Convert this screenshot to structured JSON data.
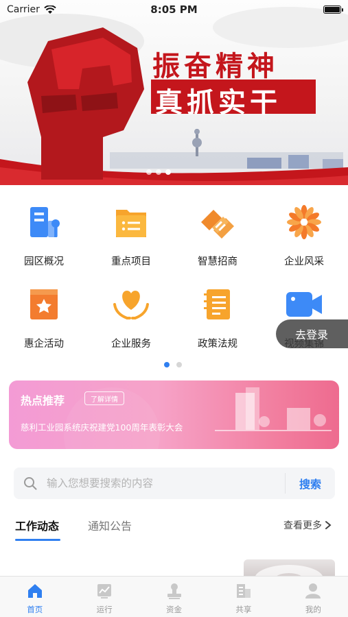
{
  "status_bar": {
    "carrier": "Carrier",
    "time": "8:05 PM"
  },
  "banner": {
    "slogan_line1": "振奋精神",
    "slogan_line2": "真抓实干",
    "slide_count": 3,
    "active_slide": 2
  },
  "grid": {
    "items": [
      {
        "label": "园区概况",
        "icon": "building-icon"
      },
      {
        "label": "重点项目",
        "icon": "folder-list-icon"
      },
      {
        "label": "智慧招商",
        "icon": "handshake-icon"
      },
      {
        "label": "企业风采",
        "icon": "flower-icon"
      },
      {
        "label": "惠企活动",
        "icon": "star-ribbon-icon"
      },
      {
        "label": "企业服务",
        "icon": "heart-hands-icon"
      },
      {
        "label": "政策法规",
        "icon": "document-icon"
      },
      {
        "label": "视频集锦",
        "icon": "video-camera-icon"
      }
    ],
    "page_count": 2,
    "active_page": 0
  },
  "login_pill": {
    "label": "去登录"
  },
  "hot": {
    "title": "热点推荐",
    "detail_label": "了解详情",
    "text": "慈利工业园系统庆祝建党100周年表彰大会"
  },
  "search": {
    "placeholder": "输入您想要搜索的内容",
    "button": "搜索"
  },
  "tabs": {
    "work": "工作动态",
    "notice": "通知公告",
    "more": "查看更多"
  },
  "tabbar": {
    "items": [
      {
        "label": "首页",
        "icon": "home-icon",
        "active": true
      },
      {
        "label": "运行",
        "icon": "chart-icon",
        "active": false
      },
      {
        "label": "资金",
        "icon": "stamp-icon",
        "active": false
      },
      {
        "label": "共享",
        "icon": "buildings-icon",
        "active": false
      },
      {
        "label": "我的",
        "icon": "user-icon",
        "active": false
      }
    ]
  },
  "colors": {
    "accent": "#2f7ff0",
    "banner_red": "#c4161c",
    "orange": "#f79a2b"
  }
}
